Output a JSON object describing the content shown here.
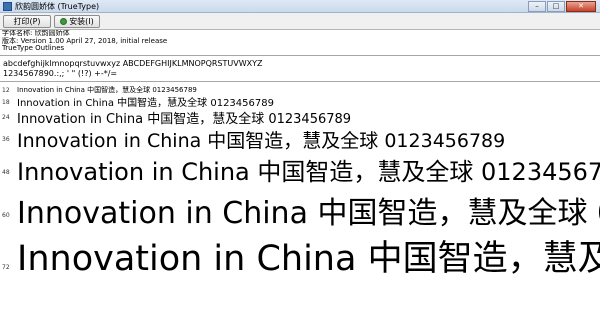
{
  "window": {
    "title": "欣韵圆娇体 (TrueType)",
    "buttons": {
      "min": "–",
      "max": "□",
      "close": "✕"
    }
  },
  "toolbar": {
    "print_label": "打印(P)",
    "install_label": "安装(I)"
  },
  "info": {
    "font_name": "字体名称: 欣韵圆娇体",
    "version": "版本: Version 1.00 April 27, 2018, initial release",
    "outline": "TrueType Outlines"
  },
  "charset": {
    "lower": "abcdefghijklmnopqrstuvwxyz ABCDEFGHIJKLMNOPQRSTUVWXYZ",
    "digits": "1234567890.:,; ' \" (!?) +-*/="
  },
  "sample_text": "Innovation in China 中国智造，慧及全球 0123456789",
  "samples": [
    {
      "size": "12"
    },
    {
      "size": "18"
    },
    {
      "size": "24"
    },
    {
      "size": "36"
    },
    {
      "size": "48"
    },
    {
      "size": "60"
    },
    {
      "size": "72"
    }
  ]
}
